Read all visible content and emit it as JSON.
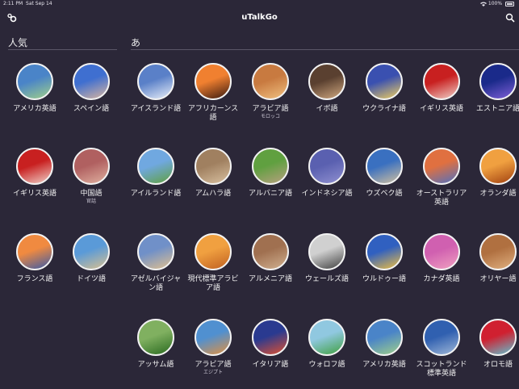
{
  "status": {
    "time": "2:11 PM",
    "date": "Sat Sep 14",
    "battery": "100%"
  },
  "nav": {
    "title": "uTalkGo"
  },
  "sections": {
    "popular": "人気",
    "a": "あ"
  },
  "colors": {
    "background": "#2b2738"
  },
  "popular": [
    {
      "label": "アメリカ英語",
      "sub": "",
      "icon": "statue-of-liberty-icon",
      "c1": "#4a84c8",
      "c2": "#9fd08a"
    },
    {
      "label": "スペイン語",
      "sub": "",
      "icon": "madrid-gate-icon",
      "c1": "#3f6fd0",
      "c2": "#d8b5a0"
    },
    {
      "label": "イギリス英語",
      "sub": "",
      "icon": "red-telephone-box-icon",
      "c1": "#c82020",
      "c2": "#f0d0c8"
    },
    {
      "label": "中国語",
      "sub": "官話",
      "icon": "terracotta-warriors-icon",
      "c1": "#b06060",
      "c2": "#e0b0a0"
    },
    {
      "label": "フランス語",
      "sub": "",
      "icon": "eiffel-tower-icon",
      "c1": "#f08a40",
      "c2": "#3a5aa8"
    },
    {
      "label": "ドイツ語",
      "sub": "",
      "icon": "brandenburg-gate-icon",
      "c1": "#5a9ad8",
      "c2": "#d8c090"
    }
  ],
  "languages": [
    [
      {
        "label": "アイスランド語",
        "sub": "",
        "icon": "iceland-snow-icon",
        "c1": "#5a80c8",
        "c2": "#e8eef8"
      },
      {
        "label": "アフリカーンス語",
        "sub": "",
        "icon": "african-sunset-icon",
        "c1": "#f08030",
        "c2": "#3a1a10"
      },
      {
        "label": "アラビア語",
        "sub": "モロッコ",
        "icon": "moroccan-town-icon",
        "c1": "#c87a40",
        "c2": "#f0c080"
      },
      {
        "label": "イボ語",
        "sub": "",
        "icon": "african-carving-icon",
        "c1": "#5a4030",
        "c2": "#d0a880"
      },
      {
        "label": "ウクライナ語",
        "sub": "",
        "icon": "golden-domes-icon",
        "c1": "#3a50b0",
        "c2": "#f0d060"
      },
      {
        "label": "イギリス英語",
        "sub": "",
        "icon": "red-telephone-box-icon",
        "c1": "#c82020",
        "c2": "#f0d0c8"
      },
      {
        "label": "エストニア語",
        "sub": "",
        "icon": "night-city-icon",
        "c1": "#1a2a8a",
        "c2": "#8060d8"
      }
    ],
    [
      {
        "label": "アイルランド語",
        "sub": "",
        "icon": "irish-castle-icon",
        "c1": "#70a8e0",
        "c2": "#60a040"
      },
      {
        "label": "アムハラ語",
        "sub": "",
        "icon": "rock-church-icon",
        "c1": "#a08060",
        "c2": "#d8c0a0"
      },
      {
        "label": "アルバニア語",
        "sub": "",
        "icon": "green-hills-icon",
        "c1": "#60a040",
        "c2": "#b8a080"
      },
      {
        "label": "インドネシア語",
        "sub": "",
        "icon": "temple-icon",
        "c1": "#5a60b0",
        "c2": "#9090d0"
      },
      {
        "label": "ウズベク語",
        "sub": "",
        "icon": "mosque-dome-icon",
        "c1": "#3a70c0",
        "c2": "#d0c0a0"
      },
      {
        "label": "オーストラリア英語",
        "sub": "",
        "icon": "opera-house-icon",
        "c1": "#e07040",
        "c2": "#5070c0"
      },
      {
        "label": "オランダ語",
        "sub": "",
        "icon": "windmill-icon",
        "c1": "#f0a040",
        "c2": "#a04010"
      }
    ],
    [
      {
        "label": "アゼルバイジャン語",
        "sub": "",
        "icon": "desert-hill-icon",
        "c1": "#7090c8",
        "c2": "#e0c090"
      },
      {
        "label": "現代標準アラビア語",
        "sub": "",
        "icon": "desert-camels-icon",
        "c1": "#f0a040",
        "c2": "#c06020"
      },
      {
        "label": "アルメニア語",
        "sub": "",
        "icon": "armenian-church-icon",
        "c1": "#a07050",
        "c2": "#d0b090"
      },
      {
        "label": "ウェールズ語",
        "sub": "",
        "icon": "welsh-letters-icon",
        "c1": "#d0d0d0",
        "c2": "#404040"
      },
      {
        "label": "ウルドゥー語",
        "sub": "",
        "icon": "fort-icon",
        "c1": "#3060c0",
        "c2": "#f0c040"
      },
      {
        "label": "カナダ英語",
        "sub": "",
        "icon": "cn-tower-icon",
        "c1": "#d060b0",
        "c2": "#f0a0c0"
      },
      {
        "label": "オリヤー語",
        "sub": "",
        "icon": "stone-temple-icon",
        "c1": "#b07040",
        "c2": "#e0b080"
      }
    ],
    [
      {
        "label": "アッサム語",
        "sub": "",
        "icon": "tea-garden-icon",
        "c1": "#80b060",
        "c2": "#2a6a20"
      },
      {
        "label": "アラビア語",
        "sub": "エジプト",
        "icon": "pyramids-icon",
        "c1": "#5090d0",
        "c2": "#e09040"
      },
      {
        "label": "イタリア語",
        "sub": "",
        "icon": "florence-dome-icon",
        "c1": "#2a3a90",
        "c2": "#e05030"
      },
      {
        "label": "ウォロフ語",
        "sub": "",
        "icon": "green-fields-icon",
        "c1": "#90c8e0",
        "c2": "#40a040"
      },
      {
        "label": "アメリカ英語",
        "sub": "",
        "icon": "statue-of-liberty-icon",
        "c1": "#4a84c8",
        "c2": "#9fd08a"
      },
      {
        "label": "スコットランド標準英語",
        "sub": "",
        "icon": "lighthouse-icon",
        "c1": "#3060b0",
        "c2": "#a0b8d8"
      },
      {
        "label": "オロモ語",
        "sub": "",
        "icon": "colorful-boats-icon",
        "c1": "#d02030",
        "c2": "#60c0d0"
      }
    ]
  ]
}
